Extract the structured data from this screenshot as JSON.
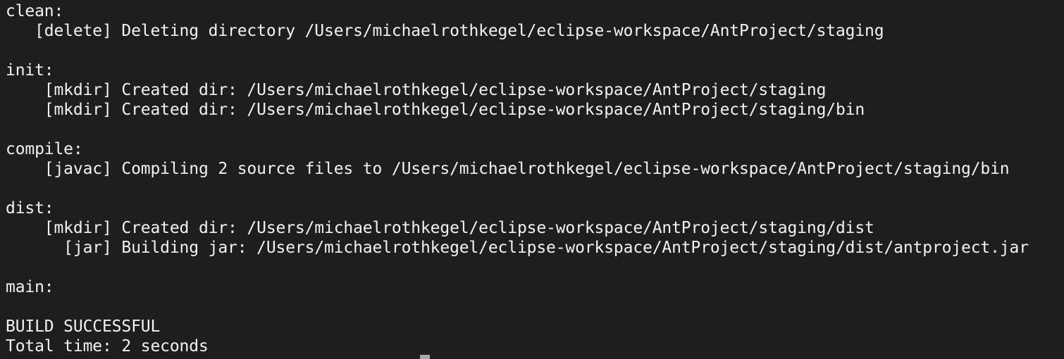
{
  "terminal": {
    "lines": [
      "clean:",
      "   [delete] Deleting directory /Users/michaelrothkegel/eclipse-workspace/AntProject/staging",
      "",
      "init:",
      "    [mkdir] Created dir: /Users/michaelrothkegel/eclipse-workspace/AntProject/staging",
      "    [mkdir] Created dir: /Users/michaelrothkegel/eclipse-workspace/AntProject/staging/bin",
      "",
      "compile:",
      "    [javac] Compiling 2 source files to /Users/michaelrothkegel/eclipse-workspace/AntProject/staging/bin",
      "",
      "dist:",
      "    [mkdir] Created dir: /Users/michaelrothkegel/eclipse-workspace/AntProject/staging/dist",
      "      [jar] Building jar: /Users/michaelrothkegel/eclipse-workspace/AntProject/staging/dist/antproject.jar",
      "",
      "main:",
      "",
      "BUILD SUCCESSFUL",
      "Total time: 2 seconds"
    ]
  }
}
